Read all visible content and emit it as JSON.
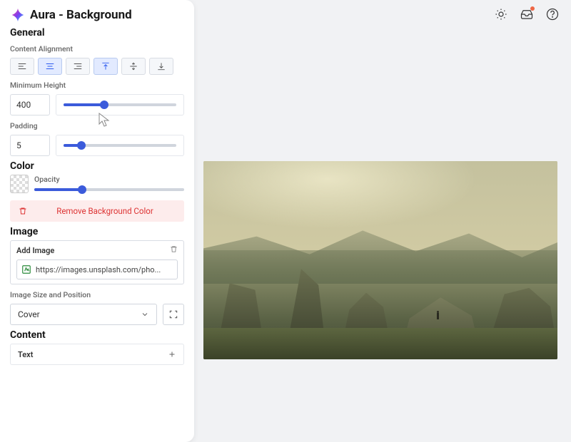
{
  "panel": {
    "title": "Aura - Background",
    "section_general": "General",
    "label_content_alignment": "Content Alignment",
    "label_min_height": "Minimum Height",
    "min_height_value": "400",
    "label_padding": "Padding",
    "padding_value": "5",
    "section_color": "Color",
    "label_opacity": "Opacity",
    "remove_bg_label": "Remove Background Color",
    "section_image": "Image",
    "add_image_label": "Add Image",
    "image_url": "https://images.unsplash.com/pho...",
    "label_image_size": "Image Size and Position",
    "image_size_value": "Cover",
    "section_content": "Content",
    "content_item": "Text"
  },
  "topbar": {}
}
